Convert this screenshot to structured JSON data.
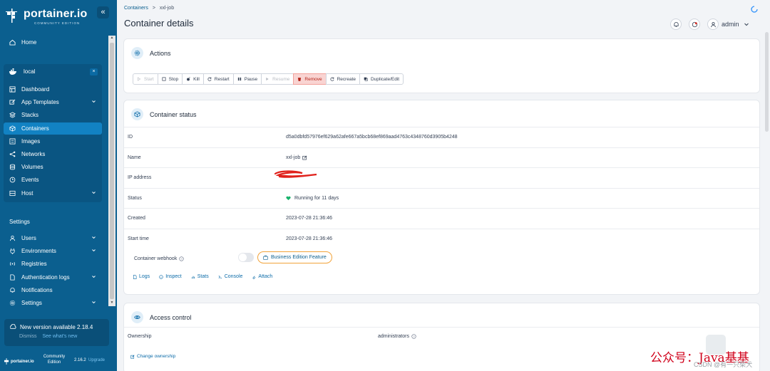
{
  "app": {
    "brand": "portainer.io",
    "edition": "COMMUNITY EDITION",
    "collapse": "«"
  },
  "nav": {
    "home": "Home",
    "environment": "local",
    "env_close": "×",
    "env_items": [
      {
        "label": "Dashboard",
        "icon": "dashboard-icon"
      },
      {
        "label": "App Templates",
        "icon": "edit-icon",
        "chevron": true
      },
      {
        "label": "Stacks",
        "icon": "layers-icon"
      },
      {
        "label": "Containers",
        "icon": "box-icon",
        "active": true
      },
      {
        "label": "Images",
        "icon": "list-icon"
      },
      {
        "label": "Networks",
        "icon": "share-icon"
      },
      {
        "label": "Volumes",
        "icon": "database-icon"
      },
      {
        "label": "Events",
        "icon": "clock-icon"
      },
      {
        "label": "Host",
        "icon": "server-icon",
        "chevron": true
      }
    ],
    "settings_label": "Settings",
    "settings_items": [
      {
        "label": "Users",
        "icon": "user-icon",
        "chevron": true
      },
      {
        "label": "Environments",
        "icon": "plug-icon",
        "chevron": true
      },
      {
        "label": "Registries",
        "icon": "radio-icon"
      },
      {
        "label": "Authentication logs",
        "icon": "file-icon",
        "chevron": true
      },
      {
        "label": "Notifications",
        "icon": "bell-icon"
      },
      {
        "label": "Settings",
        "icon": "gear-icon",
        "chevron": true
      }
    ]
  },
  "update": {
    "title": "New version available 2.18.4",
    "dismiss": "Dismiss",
    "whats_new": "See what's new"
  },
  "footer": {
    "brand": "portainer.io",
    "community": "Community",
    "edition": "Edition",
    "version": "2.16.2",
    "upgrade": "Upgrade"
  },
  "header": {
    "breadcrumb_link": "Containers",
    "breadcrumb_sep": ">",
    "breadcrumb_current": "xxl-job",
    "title": "Container details",
    "user": "admin"
  },
  "actions": {
    "title": "Actions",
    "buttons": [
      {
        "label": "Start",
        "state": "disabled"
      },
      {
        "label": "Stop",
        "state": "normal"
      },
      {
        "label": "Kill",
        "state": "normal"
      },
      {
        "label": "Restart",
        "state": "normal"
      },
      {
        "label": "Pause",
        "state": "normal"
      },
      {
        "label": "Resume",
        "state": "disabled"
      },
      {
        "label": "Remove",
        "state": "danger"
      },
      {
        "label": "Recreate",
        "state": "normal"
      },
      {
        "label": "Duplicate/Edit",
        "state": "normal"
      }
    ]
  },
  "status": {
    "title": "Container status",
    "rows": [
      {
        "key": "ID",
        "value": "d5a0dbfd57976ef629a62afe667a5bcb68ef869aad4763c4348760d3905b4248"
      },
      {
        "key": "Name",
        "value": "xxl-job"
      },
      {
        "key": "IP address",
        "value": ""
      },
      {
        "key": "Status",
        "value": "Running for 11 days"
      },
      {
        "key": "Created",
        "value": "2023-07-28 21:36:46"
      },
      {
        "key": "Start time",
        "value": "2023-07-28 21:36:46"
      }
    ],
    "webhook_label": "Container webhook",
    "be_feature": "Business Edition Feature",
    "links": [
      "Logs",
      "Inspect",
      "Stats",
      "Console",
      "Attach"
    ]
  },
  "access": {
    "title": "Access control",
    "ownership_label": "Ownership",
    "ownership_value": "administrators",
    "change": "Change ownership"
  },
  "watermark": {
    "text": "公众号：Java基基",
    "sub": "CSDN @有一只柴犬"
  },
  "colors": {
    "sidebar": "#0b5f8f",
    "active": "#1282c3",
    "accent": "#0b6ba8",
    "danger": "#f9d4d2",
    "running": "#17b26a"
  }
}
